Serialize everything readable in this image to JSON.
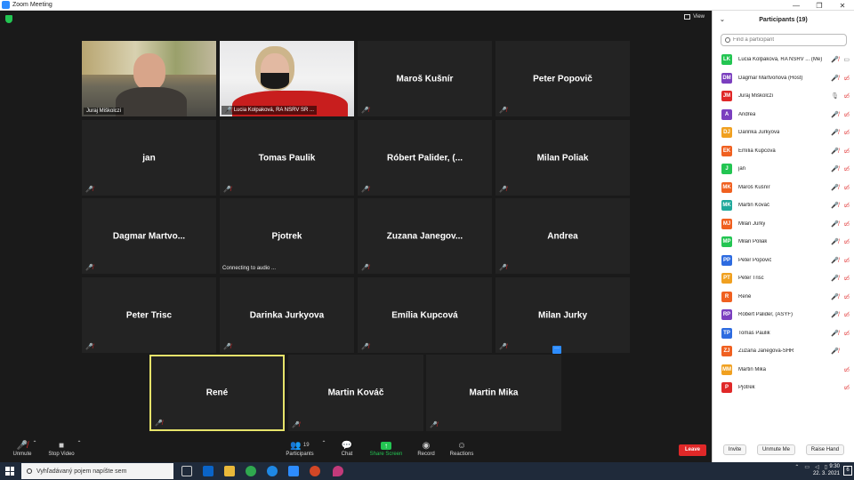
{
  "window": {
    "title": "Zoom Meeting",
    "controls": [
      "—",
      "❐",
      "✕"
    ]
  },
  "meeting": {
    "view_label": "View",
    "tiles": [
      {
        "name": "Juraj Miškolczi",
        "type": "video-juraj"
      },
      {
        "name": "Lucia Kolpaková, RA NSRV SR ...",
        "type": "video-lucia"
      },
      {
        "name": "Maroš Kušnír"
      },
      {
        "name": "Peter Popovič"
      },
      {
        "name": "jan"
      },
      {
        "name": "Tomas Paulik"
      },
      {
        "name": "Róbert Palider, (..."
      },
      {
        "name": "Milan Poliak"
      },
      {
        "name": "Dagmar  Martvo..."
      },
      {
        "name": "Pjotrek",
        "status": "Connecting to audio ..."
      },
      {
        "name": "Zuzana  Janegov..."
      },
      {
        "name": "Andrea"
      },
      {
        "name": "Peter Trisc"
      },
      {
        "name": "Darinka Jurkyova"
      },
      {
        "name": "Emília Kupcová"
      },
      {
        "name": "Milan Jurky"
      },
      {
        "name": "René",
        "active": true
      },
      {
        "name": "Martin Kováč"
      },
      {
        "name": "Martin Mika",
        "more": "···"
      }
    ]
  },
  "toolbar": {
    "unmute": "Unmute",
    "stop_video": "Stop Video",
    "participants": "Participants",
    "participants_count": "19",
    "chat": "Chat",
    "share_screen": "Share Screen",
    "record": "Record",
    "reactions": "Reactions",
    "leave": "Leave"
  },
  "panel": {
    "title": "Participants (19)",
    "search_placeholder": "Find a participant",
    "participants": [
      {
        "initials": "LK",
        "name": "Lucia Kolpaková, RA NSRV ...  (Me)",
        "color": "#23c552",
        "mic": "muted",
        "cam": "on"
      },
      {
        "initials": "DM",
        "name": "Dagmar Martvoňová (Host)",
        "color": "#7b3fbf",
        "mic": "muted",
        "cam": "off"
      },
      {
        "initials": "JM",
        "name": "Juraj Miškolczi",
        "color": "#e02828",
        "mic": "on",
        "cam": "off"
      },
      {
        "initials": "A",
        "name": "Andrea",
        "color": "#7b3fbf",
        "mic": "muted",
        "cam": "off"
      },
      {
        "initials": "DJ",
        "name": "Darinka Jurkyova",
        "color": "#f0a020",
        "mic": "muted",
        "cam": "off"
      },
      {
        "initials": "EK",
        "name": "Emília Kupcová",
        "color": "#f06020",
        "mic": "muted",
        "cam": "off"
      },
      {
        "initials": "J",
        "name": "jan",
        "color": "#23c552",
        "mic": "muted",
        "cam": "off"
      },
      {
        "initials": "MK",
        "name": "Maroš Kušnír",
        "color": "#f06020",
        "mic": "muted",
        "cam": "off"
      },
      {
        "initials": "MK",
        "name": "Martin Kováč",
        "color": "#1fa89b",
        "mic": "muted",
        "cam": "off"
      },
      {
        "initials": "MJ",
        "name": "Milan Jurky",
        "color": "#f06020",
        "mic": "muted",
        "cam": "off"
      },
      {
        "initials": "MP",
        "name": "Milan Poliak",
        "color": "#23c552",
        "mic": "muted",
        "cam": "off"
      },
      {
        "initials": "PP",
        "name": "Peter Popovič",
        "color": "#2d6be0",
        "mic": "muted",
        "cam": "off"
      },
      {
        "initials": "PT",
        "name": "Peter Trisc",
        "color": "#f0a020",
        "mic": "muted",
        "cam": "off"
      },
      {
        "initials": "R",
        "name": "René",
        "color": "#f06020",
        "mic": "muted",
        "cam": "off"
      },
      {
        "initials": "RP",
        "name": "Róbert Palider, (ASYF)",
        "color": "#7b3fbf",
        "mic": "muted",
        "cam": "off"
      },
      {
        "initials": "TP",
        "name": "Tomas Paulik",
        "color": "#2d6be0",
        "mic": "muted",
        "cam": "off"
      },
      {
        "initials": "ZJ",
        "name": "Zuzana Janegová-SHR",
        "color": "#f06020",
        "mic": "muted",
        "cam": "none"
      },
      {
        "initials": "MM",
        "name": "Martin Mika",
        "color": "#f0a020",
        "mic": "none",
        "cam": "off"
      },
      {
        "initials": "P",
        "name": "Pjotrek",
        "color": "#e02828",
        "mic": "none",
        "cam": "off"
      }
    ],
    "invite": "Invite",
    "unmute_me": "Unmute Me",
    "raise_hand": "Raise Hand"
  },
  "taskbar": {
    "search_placeholder": "Vyhľadávaný pojem napíšte sem",
    "time": "9:30",
    "date": "22. 3. 2021",
    "notifications": "6"
  }
}
